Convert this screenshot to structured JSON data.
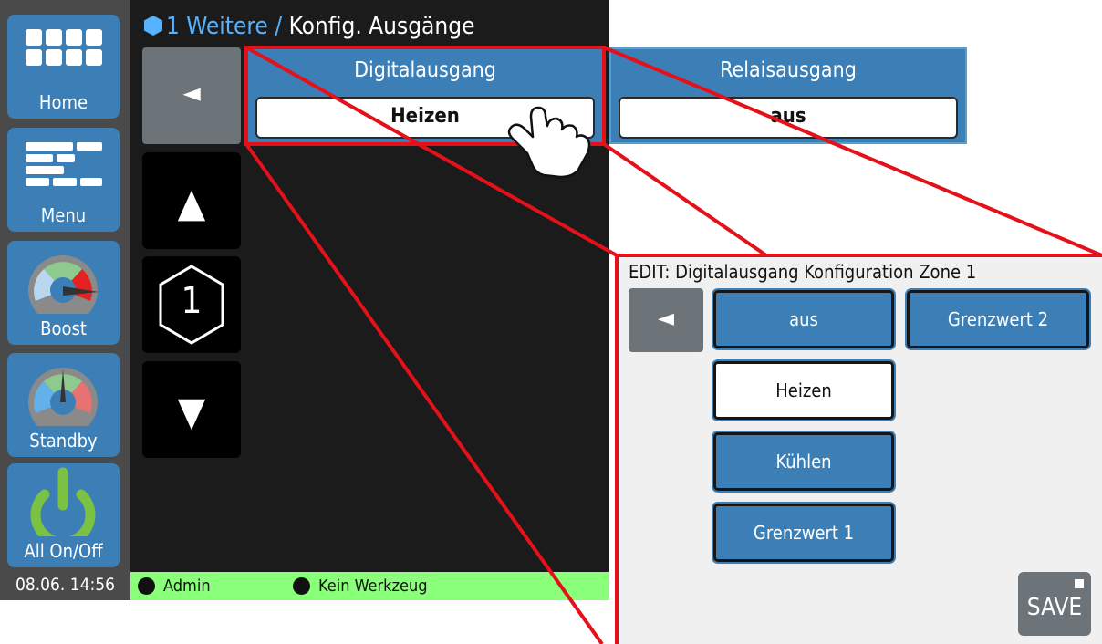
{
  "sidebar": {
    "items": [
      {
        "label": "Home",
        "icon": "home-grid-icon"
      },
      {
        "label": "Menu",
        "icon": "menu-list-icon"
      },
      {
        "label": "Boost",
        "icon": "boost-gauge-icon"
      },
      {
        "label": "Standby",
        "icon": "standby-gauge-icon"
      },
      {
        "label": "All On/Off",
        "icon": "power-icon"
      }
    ],
    "datetime": "08.06. 14:56"
  },
  "breadcrumb": {
    "link": "1 Weitere",
    "separator": " / ",
    "current": "Konfig. Ausgänge"
  },
  "nav": {
    "back": "◄",
    "up": "▲",
    "zone_number": "1",
    "down": "▼"
  },
  "outputs": [
    {
      "title": "Digitalausgang",
      "value": "Heizen"
    },
    {
      "title": "Relaisausgang",
      "value": "aus"
    }
  ],
  "status_bar": {
    "user": "Admin",
    "tool": "Kein Werkzeug"
  },
  "edit": {
    "title": "EDIT: Digitalausgang Konfiguration Zone 1",
    "back": "◄",
    "options": [
      "aus",
      "Grenzwert 2",
      "Heizen",
      "Kühlen",
      "Grenzwert 1"
    ],
    "selected": "Heizen",
    "save_label": "SAVE"
  },
  "colors": {
    "accent_blue": "#3b7fb6",
    "link_blue": "#55b2ff",
    "status_green": "#8aff7a",
    "callout_red": "#e4101a",
    "screen_bg": "#1b1b1b"
  }
}
